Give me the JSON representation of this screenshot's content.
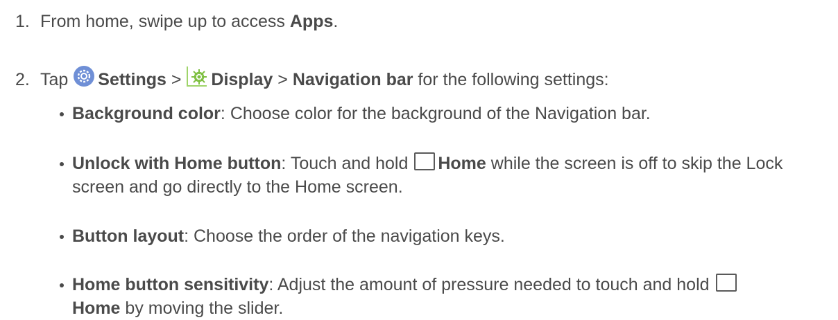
{
  "steps": [
    {
      "number": "1.",
      "pre": "From home, swipe up to access ",
      "bold": "Apps",
      "post": "."
    },
    {
      "number": "2.",
      "tap": "Tap ",
      "settings": "Settings",
      "sep1": " > ",
      "display": "Display",
      "sep2": " > ",
      "navbar": "Navigation bar",
      "post": " for the following settings:"
    }
  ],
  "bullets": [
    {
      "title": "Background color",
      "text": ": Choose color for the background of the Navigation bar."
    },
    {
      "title": "Unlock with Home button",
      "text1": ": Touch and hold ",
      "home": "Home",
      "text2": " while the screen is off to skip the Lock screen and go directly to the Home screen."
    },
    {
      "title": "Button layout",
      "text": ": Choose the order of the navigation keys."
    },
    {
      "title": "Home button sensitivity",
      "text1": ": Adjust the amount of pressure needed to touch and hold ",
      "home": "Home",
      "text2": " by moving the slider."
    }
  ],
  "icons": {
    "settings": "settings-gear-icon",
    "display": "display-icon",
    "home": "home-key-icon"
  },
  "colors": {
    "text": "#4a4a4a",
    "settings_icon": "#6f8fd6",
    "display_icon": "#7dbf3f"
  }
}
